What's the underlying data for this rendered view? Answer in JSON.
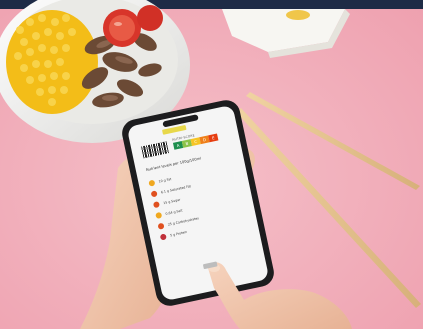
{
  "scene": {
    "description_colors": {
      "background": "#f2b6c0",
      "top_bar": "#1e2b46",
      "bowl": "#f4f4f2",
      "corn": "#f4c21a",
      "tomato": "#d8352a",
      "mushroom": "#6b4a35",
      "chopstick": "#e6c48d",
      "phone_frame": "#1c1c1e",
      "phone_screen": "#f5f5f5",
      "skin": "#f1c9b0"
    }
  },
  "phone": {
    "header_badge": "",
    "nutri_label": "NUTRI-SCORE",
    "nutri_grades": [
      "A",
      "B",
      "C",
      "D",
      "E"
    ],
    "section_title": "Nutrient levels per 100g/100ml",
    "rows": [
      {
        "label": "10 g Fat",
        "color": "#f0a81f"
      },
      {
        "label": "6.1 g Saturated Fat",
        "color": "#e0501f"
      },
      {
        "label": "15 g Sugar",
        "color": "#e0501f"
      },
      {
        "label": "0.64 g Salt",
        "color": "#f0a81f"
      },
      {
        "label": "25 g Carbohydrates",
        "color": "#e0501f"
      },
      {
        "label": "5 g Protein",
        "color": "#c0303a"
      }
    ]
  }
}
